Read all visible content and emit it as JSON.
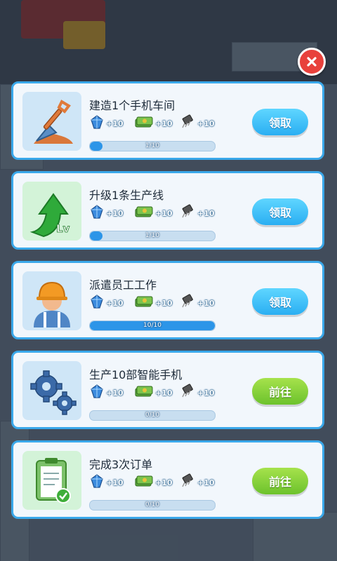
{
  "close_label": "",
  "colors": {
    "card_border": "#3aa8ea",
    "claim_button": "#2aaef2",
    "goto_button": "#6cc22c",
    "progress": "#2c95e8"
  },
  "tasks": [
    {
      "title": "建造1个手机车间",
      "icon": "shovel-icon",
      "rewards": [
        "+10",
        "+10",
        "+10"
      ],
      "progress_text": "1/10",
      "progress": 0.1,
      "button": "领取",
      "button_style": "claim"
    },
    {
      "title": "升级1条生产线",
      "icon": "level-up-arrow-icon",
      "rewards": [
        "+10",
        "+10",
        "+10"
      ],
      "progress_text": "1/10",
      "progress": 0.1,
      "button": "领取",
      "button_style": "claim"
    },
    {
      "title": "派遣员工工作",
      "icon": "worker-icon",
      "rewards": [
        "+10",
        "+10",
        "+10"
      ],
      "progress_text": "10/10",
      "progress": 1.0,
      "button": "领取",
      "button_style": "claim"
    },
    {
      "title": "生产10部智能手机",
      "icon": "gears-icon",
      "rewards": [
        "+10",
        "+10",
        "+10"
      ],
      "progress_text": "0/10",
      "progress": 0.0,
      "button": "前往",
      "button_style": "goto"
    },
    {
      "title": "完成3次订单",
      "icon": "clipboard-icon",
      "rewards": [
        "+10",
        "+10",
        "+10"
      ],
      "progress_text": "0/10",
      "progress": 0.0,
      "button": "前往",
      "button_style": "goto"
    }
  ],
  "reward_icons": [
    "gem-icon",
    "cash-icon",
    "chip-icon"
  ]
}
